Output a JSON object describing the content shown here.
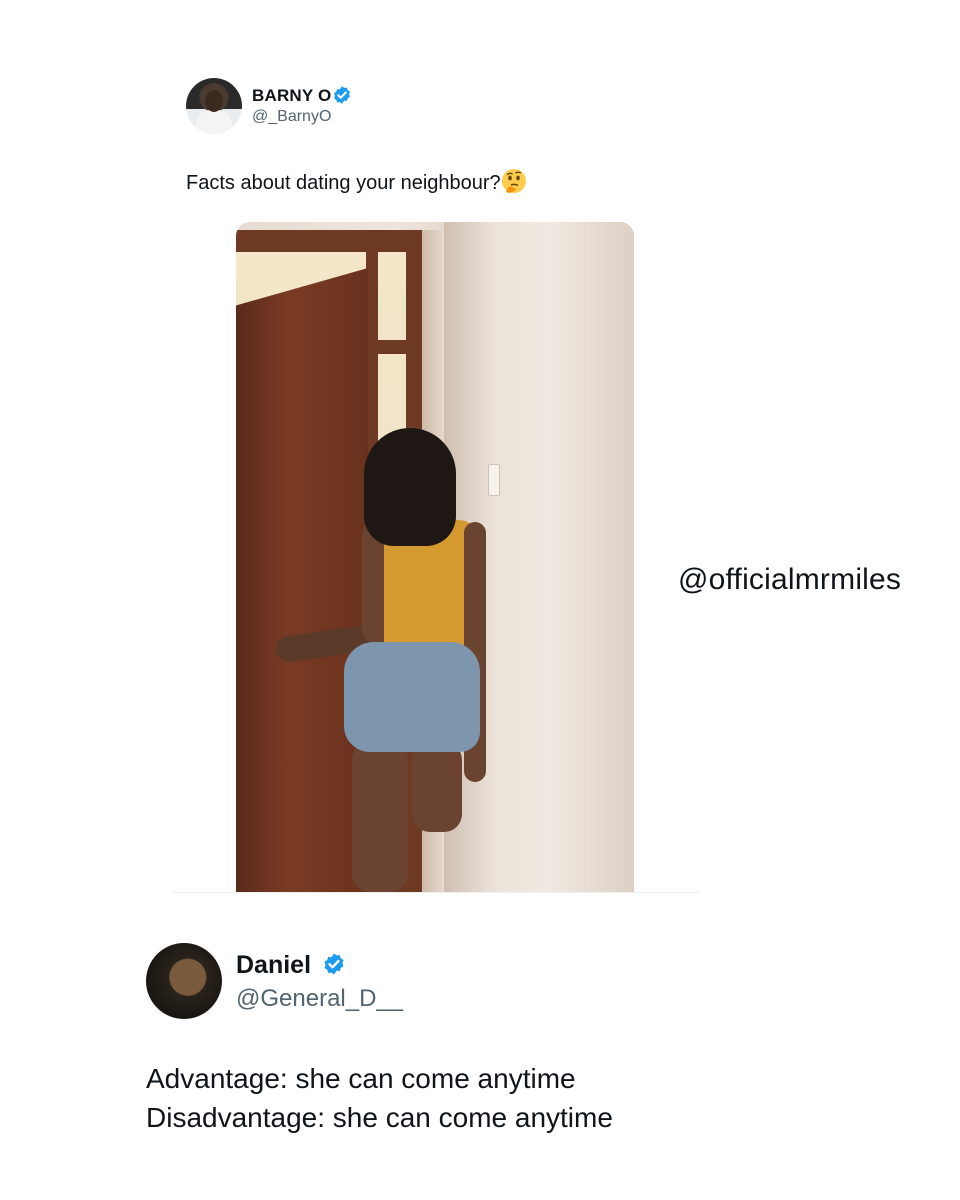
{
  "tweet1": {
    "display_name": "BARNY O",
    "handle": "@_BarnyO",
    "text": "Facts about dating your neighbour?",
    "emoji": "thinking-face",
    "verified_color": "#1d9bf0"
  },
  "watermark": "@officialmrmiles",
  "tweet2": {
    "display_name": "Daniel",
    "handle": "@General_D__",
    "line1": "Advantage: she can come anytime",
    "line2": "Disadvantage: she can come anytime",
    "verified_color": "#1d9bf0"
  }
}
